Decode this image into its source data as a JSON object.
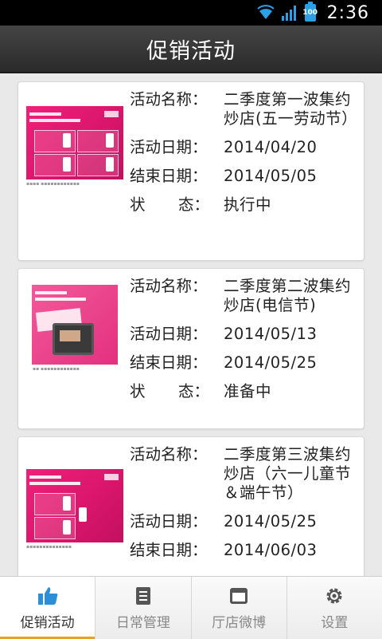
{
  "status_bar": {
    "time": "2:36",
    "battery": "100"
  },
  "header": {
    "title": "促销活动"
  },
  "labels": {
    "name": "活动名称：",
    "date": "活动日期：",
    "end": "结束日期：",
    "status_a": "状",
    "status_b": "态："
  },
  "cards": [
    {
      "name": "二季度第一波集约炒店(五一劳动节）",
      "date": "2014/04/20",
      "end": "2014/05/05",
      "status": "执行中"
    },
    {
      "name": "二季度第二波集约炒店(电信节)",
      "date": "2014/05/13",
      "end": "2014/05/25",
      "status": "准备中"
    },
    {
      "name": "二季度第三波集约炒店（六一儿童节＆端午节）",
      "date": "2014/05/25",
      "end": "2014/06/03"
    }
  ],
  "nav": [
    {
      "label": "促销活动",
      "icon": "thumbs-up-icon",
      "active": true
    },
    {
      "label": "日常管理",
      "icon": "document-list-icon"
    },
    {
      "label": "厅店微博",
      "icon": "window-icon"
    },
    {
      "label": "设置",
      "icon": "gear-icon"
    }
  ],
  "colors": {
    "accent": "#e8a020",
    "icon_blue": "#2a8fd8",
    "poster_pink": "#e0186c"
  }
}
